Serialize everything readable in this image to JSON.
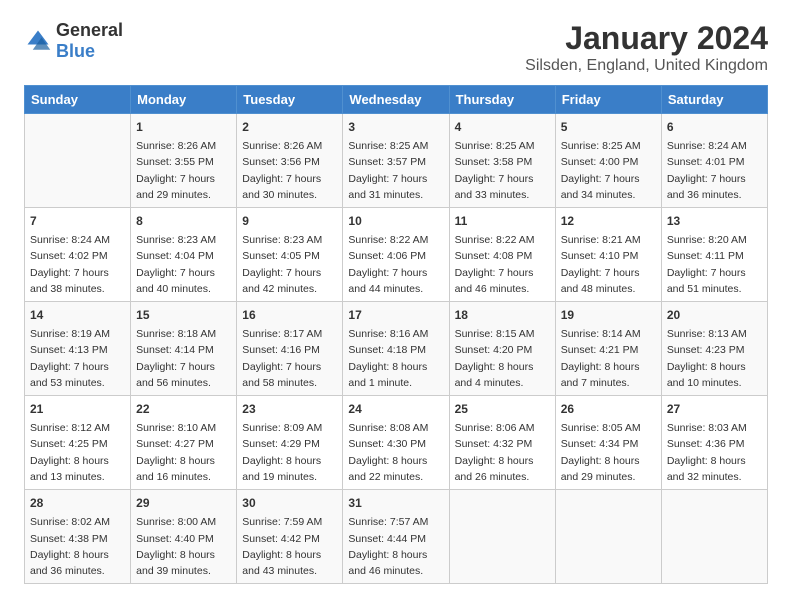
{
  "header": {
    "logo_general": "General",
    "logo_blue": "Blue",
    "title": "January 2024",
    "subtitle": "Silsden, England, United Kingdom"
  },
  "columns": [
    "Sunday",
    "Monday",
    "Tuesday",
    "Wednesday",
    "Thursday",
    "Friday",
    "Saturday"
  ],
  "weeks": [
    [
      {
        "day": "",
        "lines": []
      },
      {
        "day": "1",
        "lines": [
          "Sunrise: 8:26 AM",
          "Sunset: 3:55 PM",
          "Daylight: 7 hours",
          "and 29 minutes."
        ]
      },
      {
        "day": "2",
        "lines": [
          "Sunrise: 8:26 AM",
          "Sunset: 3:56 PM",
          "Daylight: 7 hours",
          "and 30 minutes."
        ]
      },
      {
        "day": "3",
        "lines": [
          "Sunrise: 8:25 AM",
          "Sunset: 3:57 PM",
          "Daylight: 7 hours",
          "and 31 minutes."
        ]
      },
      {
        "day": "4",
        "lines": [
          "Sunrise: 8:25 AM",
          "Sunset: 3:58 PM",
          "Daylight: 7 hours",
          "and 33 minutes."
        ]
      },
      {
        "day": "5",
        "lines": [
          "Sunrise: 8:25 AM",
          "Sunset: 4:00 PM",
          "Daylight: 7 hours",
          "and 34 minutes."
        ]
      },
      {
        "day": "6",
        "lines": [
          "Sunrise: 8:24 AM",
          "Sunset: 4:01 PM",
          "Daylight: 7 hours",
          "and 36 minutes."
        ]
      }
    ],
    [
      {
        "day": "7",
        "lines": [
          "Sunrise: 8:24 AM",
          "Sunset: 4:02 PM",
          "Daylight: 7 hours",
          "and 38 minutes."
        ]
      },
      {
        "day": "8",
        "lines": [
          "Sunrise: 8:23 AM",
          "Sunset: 4:04 PM",
          "Daylight: 7 hours",
          "and 40 minutes."
        ]
      },
      {
        "day": "9",
        "lines": [
          "Sunrise: 8:23 AM",
          "Sunset: 4:05 PM",
          "Daylight: 7 hours",
          "and 42 minutes."
        ]
      },
      {
        "day": "10",
        "lines": [
          "Sunrise: 8:22 AM",
          "Sunset: 4:06 PM",
          "Daylight: 7 hours",
          "and 44 minutes."
        ]
      },
      {
        "day": "11",
        "lines": [
          "Sunrise: 8:22 AM",
          "Sunset: 4:08 PM",
          "Daylight: 7 hours",
          "and 46 minutes."
        ]
      },
      {
        "day": "12",
        "lines": [
          "Sunrise: 8:21 AM",
          "Sunset: 4:10 PM",
          "Daylight: 7 hours",
          "and 48 minutes."
        ]
      },
      {
        "day": "13",
        "lines": [
          "Sunrise: 8:20 AM",
          "Sunset: 4:11 PM",
          "Daylight: 7 hours",
          "and 51 minutes."
        ]
      }
    ],
    [
      {
        "day": "14",
        "lines": [
          "Sunrise: 8:19 AM",
          "Sunset: 4:13 PM",
          "Daylight: 7 hours",
          "and 53 minutes."
        ]
      },
      {
        "day": "15",
        "lines": [
          "Sunrise: 8:18 AM",
          "Sunset: 4:14 PM",
          "Daylight: 7 hours",
          "and 56 minutes."
        ]
      },
      {
        "day": "16",
        "lines": [
          "Sunrise: 8:17 AM",
          "Sunset: 4:16 PM",
          "Daylight: 7 hours",
          "and 58 minutes."
        ]
      },
      {
        "day": "17",
        "lines": [
          "Sunrise: 8:16 AM",
          "Sunset: 4:18 PM",
          "Daylight: 8 hours",
          "and 1 minute."
        ]
      },
      {
        "day": "18",
        "lines": [
          "Sunrise: 8:15 AM",
          "Sunset: 4:20 PM",
          "Daylight: 8 hours",
          "and 4 minutes."
        ]
      },
      {
        "day": "19",
        "lines": [
          "Sunrise: 8:14 AM",
          "Sunset: 4:21 PM",
          "Daylight: 8 hours",
          "and 7 minutes."
        ]
      },
      {
        "day": "20",
        "lines": [
          "Sunrise: 8:13 AM",
          "Sunset: 4:23 PM",
          "Daylight: 8 hours",
          "and 10 minutes."
        ]
      }
    ],
    [
      {
        "day": "21",
        "lines": [
          "Sunrise: 8:12 AM",
          "Sunset: 4:25 PM",
          "Daylight: 8 hours",
          "and 13 minutes."
        ]
      },
      {
        "day": "22",
        "lines": [
          "Sunrise: 8:10 AM",
          "Sunset: 4:27 PM",
          "Daylight: 8 hours",
          "and 16 minutes."
        ]
      },
      {
        "day": "23",
        "lines": [
          "Sunrise: 8:09 AM",
          "Sunset: 4:29 PM",
          "Daylight: 8 hours",
          "and 19 minutes."
        ]
      },
      {
        "day": "24",
        "lines": [
          "Sunrise: 8:08 AM",
          "Sunset: 4:30 PM",
          "Daylight: 8 hours",
          "and 22 minutes."
        ]
      },
      {
        "day": "25",
        "lines": [
          "Sunrise: 8:06 AM",
          "Sunset: 4:32 PM",
          "Daylight: 8 hours",
          "and 26 minutes."
        ]
      },
      {
        "day": "26",
        "lines": [
          "Sunrise: 8:05 AM",
          "Sunset: 4:34 PM",
          "Daylight: 8 hours",
          "and 29 minutes."
        ]
      },
      {
        "day": "27",
        "lines": [
          "Sunrise: 8:03 AM",
          "Sunset: 4:36 PM",
          "Daylight: 8 hours",
          "and 32 minutes."
        ]
      }
    ],
    [
      {
        "day": "28",
        "lines": [
          "Sunrise: 8:02 AM",
          "Sunset: 4:38 PM",
          "Daylight: 8 hours",
          "and 36 minutes."
        ]
      },
      {
        "day": "29",
        "lines": [
          "Sunrise: 8:00 AM",
          "Sunset: 4:40 PM",
          "Daylight: 8 hours",
          "and 39 minutes."
        ]
      },
      {
        "day": "30",
        "lines": [
          "Sunrise: 7:59 AM",
          "Sunset: 4:42 PM",
          "Daylight: 8 hours",
          "and 43 minutes."
        ]
      },
      {
        "day": "31",
        "lines": [
          "Sunrise: 7:57 AM",
          "Sunset: 4:44 PM",
          "Daylight: 8 hours",
          "and 46 minutes."
        ]
      },
      {
        "day": "",
        "lines": []
      },
      {
        "day": "",
        "lines": []
      },
      {
        "day": "",
        "lines": []
      }
    ]
  ]
}
